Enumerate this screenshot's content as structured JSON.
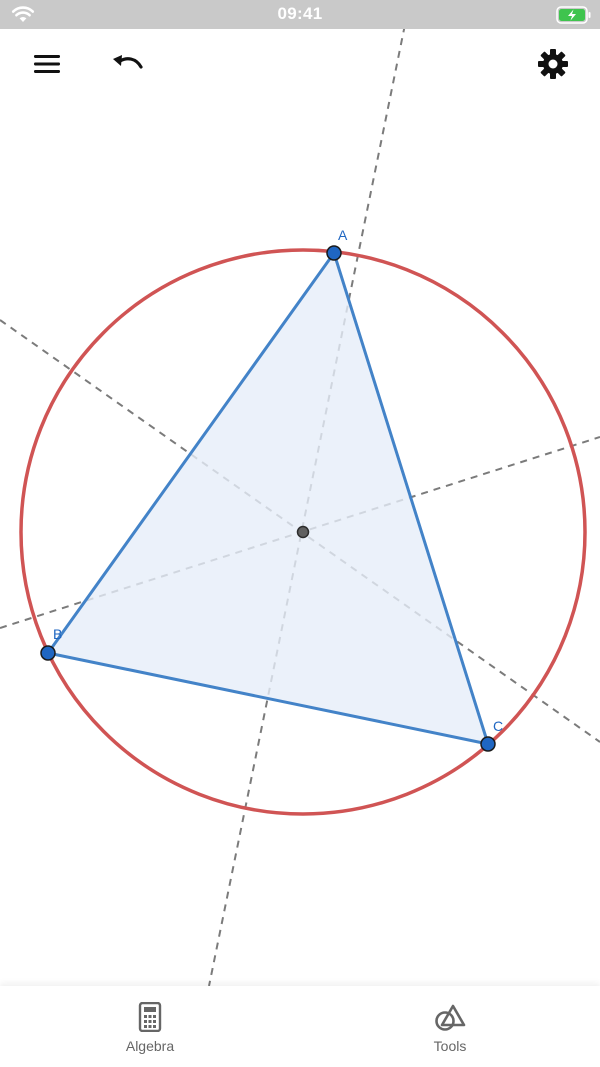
{
  "status_bar": {
    "time": "09:41",
    "wifi_icon": "wifi-icon",
    "battery_icon": "battery-charging-icon"
  },
  "toolbar": {
    "menu_icon": "hamburger-menu-icon",
    "undo_icon": "undo-icon",
    "settings_icon": "gear-icon"
  },
  "construction": {
    "points": [
      {
        "label": "A"
      },
      {
        "label": "B"
      },
      {
        "label": "C"
      }
    ],
    "center_point": "circumcenter",
    "shapes": [
      "triangle ABC",
      "circumcircle",
      "perpendicular bisectors (3)"
    ]
  },
  "colors": {
    "triangle_stroke": "#4383c8",
    "triangle_fill": "#e6eef9",
    "circle_stroke": "#d05454",
    "point_fill": "#1f66c2",
    "bisector_stroke": "#7b7b7b",
    "center_fill": "#606060"
  },
  "bottom_bar": {
    "algebra_label": "Algebra",
    "tools_label": "Tools",
    "algebra_icon": "calculator-icon",
    "tools_icon": "shapes-tools-icon"
  }
}
